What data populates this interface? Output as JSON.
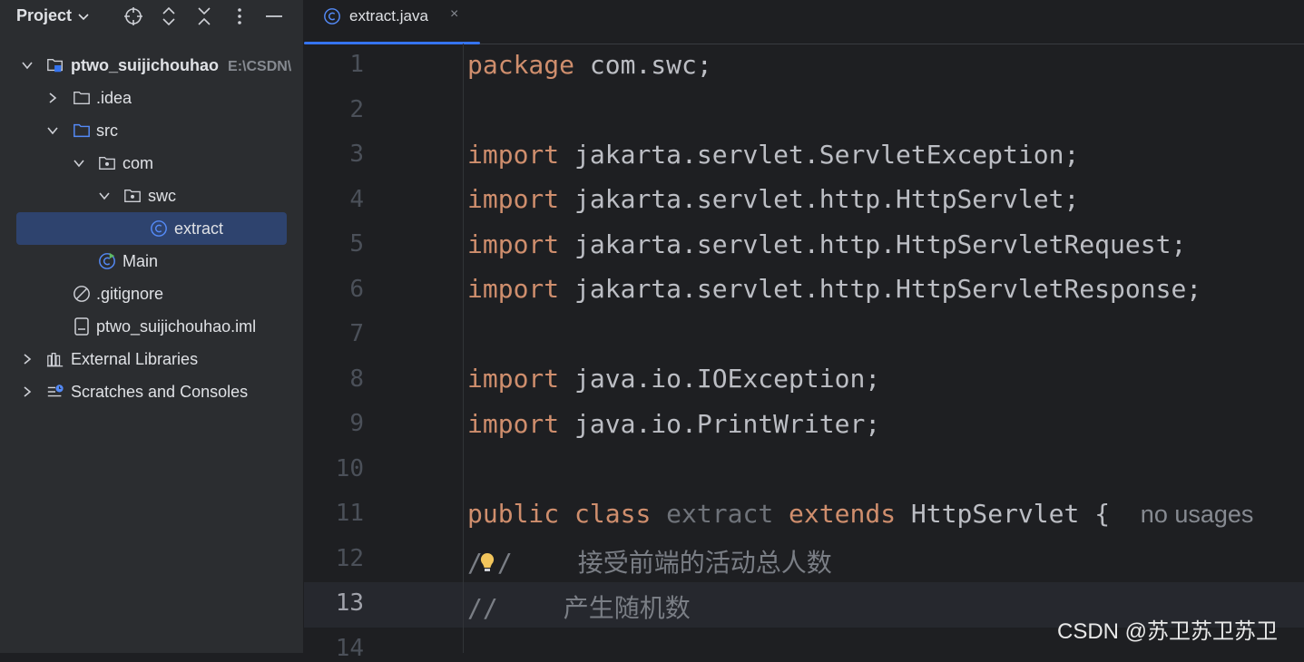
{
  "panel": {
    "title": "Project",
    "tree": [
      {
        "label": "ptwo_suijichouhao",
        "hint": "E:\\CSDN\\",
        "icon": "module-folder-icon"
      },
      {
        "label": ".idea",
        "icon": "folder-icon"
      },
      {
        "label": "src",
        "icon": "source-folder-icon"
      },
      {
        "label": "com",
        "icon": "package-icon"
      },
      {
        "label": "swc",
        "icon": "package-icon"
      },
      {
        "label": "extract",
        "icon": "class-icon"
      },
      {
        "label": "Main",
        "icon": "runnable-class-icon"
      },
      {
        "label": ".gitignore",
        "icon": "ignored-file-icon"
      },
      {
        "label": "ptwo_suijichouhao.iml",
        "icon": "module-file-icon"
      },
      {
        "label": "External Libraries",
        "icon": "library-icon"
      },
      {
        "label": "Scratches and Consoles",
        "icon": "scratches-icon"
      }
    ]
  },
  "editor": {
    "tab": {
      "label": "extract.java",
      "close": "×"
    },
    "current_line": 13,
    "line_numbers": [
      "1",
      "2",
      "3",
      "4",
      "5",
      "6",
      "7",
      "8",
      "9",
      "10",
      "11",
      "12",
      "13",
      "14"
    ],
    "lines": {
      "l1": {
        "kw": "package",
        "rest": " com.swc;"
      },
      "l3": {
        "kw": "import",
        "rest": " jakarta.servlet.ServletException;"
      },
      "l4": {
        "kw": "import",
        "rest": " jakarta.servlet.http.HttpServlet;"
      },
      "l5": {
        "kw": "import",
        "rest": " jakarta.servlet.http.HttpServletRequest;"
      },
      "l6": {
        "kw": "import",
        "rest": " jakarta.servlet.http.HttpServletResponse;"
      },
      "l8": {
        "kw": "import",
        "rest": " java.io.IOException;"
      },
      "l9": {
        "kw": "import",
        "rest": " java.io.PrintWriter;"
      },
      "l11": {
        "kw1": "public",
        "kw2": "class",
        "name": "extract",
        "kw3": "extends",
        "rest": "HttpServlet {",
        "hint": "no usages"
      },
      "l12": {
        "slash": "/",
        "slash2": "/",
        "comment": "接受前端的活动总人数"
      },
      "l13": {
        "slash": "//",
        "comment": "产生随机数"
      }
    }
  },
  "watermark": "CSDN @苏卫苏卫苏卫",
  "colors": {
    "keyword": "#cf8e6d",
    "selection": "#2e436e",
    "accent": "#3574f0"
  }
}
